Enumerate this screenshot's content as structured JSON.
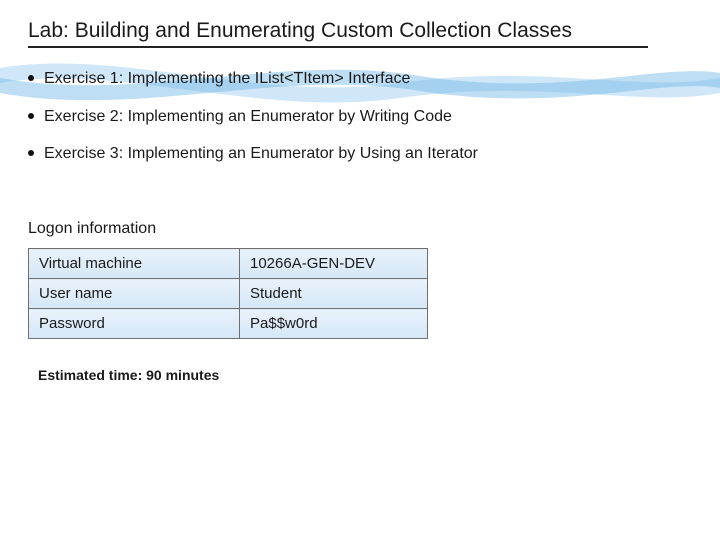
{
  "title": "Lab: Building and Enumerating Custom Collection Classes",
  "exercises": [
    "Exercise 1: Implementing the IList<TItem> Interface",
    "Exercise 2: Implementing an Enumerator by Writing Code",
    "Exercise 3: Implementing an Enumerator by Using an Iterator"
  ],
  "logon": {
    "heading": "Logon information",
    "rows": [
      {
        "label": "Virtual machine",
        "value": "10266A-GEN-DEV"
      },
      {
        "label": "User name",
        "value": "Student"
      },
      {
        "label": "Password",
        "value": "Pa$$w0rd"
      }
    ]
  },
  "estimate": "Estimated time: 90 minutes"
}
